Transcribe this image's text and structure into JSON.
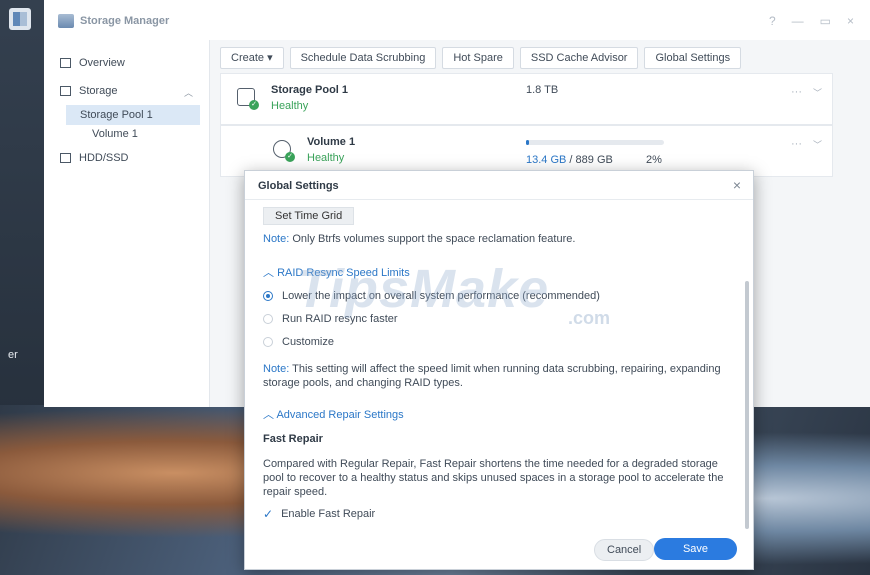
{
  "window": {
    "title": "Storage Manager",
    "controls": [
      "?",
      "—",
      "▭",
      "×"
    ]
  },
  "desktop": {
    "side_text": "er"
  },
  "sidebar": {
    "items": [
      {
        "label": "Overview"
      },
      {
        "label": "Storage"
      },
      {
        "label": "Storage Pool 1"
      },
      {
        "label": "Volume 1"
      },
      {
        "label": "HDD/SSD"
      }
    ]
  },
  "toolbar": {
    "buttons": [
      {
        "label": "Create ▾"
      },
      {
        "label": "Schedule Data Scrubbing"
      },
      {
        "label": "Hot Spare"
      },
      {
        "label": "SSD Cache Advisor"
      },
      {
        "label": "Global Settings"
      }
    ]
  },
  "pool": {
    "name": "Storage Pool 1",
    "status": "Healthy",
    "size": "1.8 TB",
    "more": "···"
  },
  "volume": {
    "name": "Volume 1",
    "status": "Healthy",
    "used": "13.4 GB",
    "separator": " / ",
    "total": "889 GB",
    "percent": "2%",
    "usage_fraction": 0.02,
    "more": "···"
  },
  "dialog": {
    "title": "Global Settings",
    "close": "×",
    "set_time_grid": "Set Time Grid",
    "note1_label": "Note:",
    "note1_text": " Only Btrfs volumes support the space reclamation feature.",
    "raid_section": "RAID Resync Speed Limits",
    "raid_options": [
      {
        "label": "Lower the impact on overall system performance (recommended)",
        "selected": true
      },
      {
        "label": "Run RAID resync faster",
        "selected": false
      },
      {
        "label": "Customize",
        "selected": false
      }
    ],
    "note2_label": "Note:",
    "note2_text": " This setting will affect the speed limit when running data scrubbing, repairing, expanding storage pools, and changing RAID types.",
    "advanced_section": "Advanced Repair Settings",
    "fast_repair_title": "Fast Repair",
    "fast_repair_desc": "Compared with Regular Repair, Fast Repair shortens the time needed for a degraded storage pool to recover to a healthy status and skips unused spaces in a storage pool to accelerate the repair speed.",
    "enable_fast_repair": "Enable Fast Repair",
    "enable_fast_repair_checked": true,
    "cancel": "Cancel",
    "save": "Save"
  },
  "watermark": {
    "main": "TipsMake",
    "suffix": ".com"
  },
  "colors": {
    "accent": "#2b77c7",
    "healthy": "#3aa35a",
    "save_button": "#2b7be0"
  }
}
